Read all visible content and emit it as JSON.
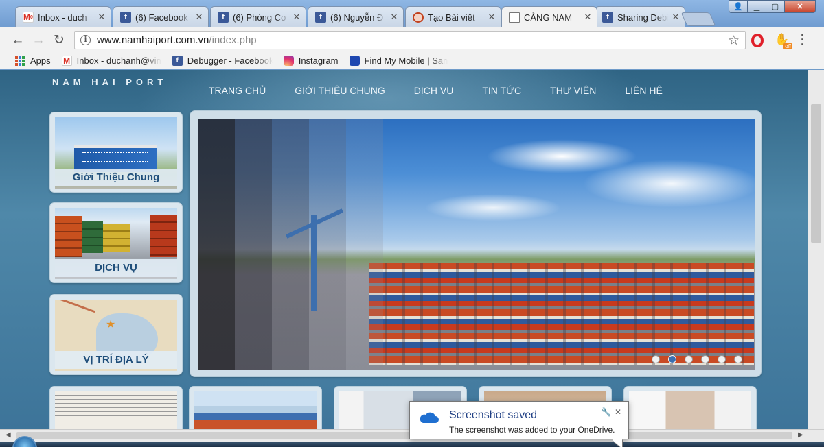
{
  "browser": {
    "tabs": [
      {
        "title": "Inbox - duch",
        "icon": "gmail-icon",
        "active": false
      },
      {
        "title": "(6) Facebook",
        "icon": "facebook-icon",
        "active": false
      },
      {
        "title": "(6) Phòng Co",
        "icon": "facebook-icon",
        "active": false
      },
      {
        "title": "(6) Nguyễn Đ",
        "icon": "facebook-icon",
        "active": false
      },
      {
        "title": "Tạo Bài viết",
        "icon": "globe-icon",
        "active": false
      },
      {
        "title": "CẢNG NAM",
        "icon": "document-icon",
        "active": true
      },
      {
        "title": "Sharing Debi",
        "icon": "facebook-icon",
        "active": false
      }
    ],
    "url_host": "www.namhaiport.com.vn",
    "url_path": "/index.php",
    "extension_badge": "off",
    "bookmarks": [
      {
        "label": "Apps",
        "icon": "apps-icon"
      },
      {
        "label": "Inbox - duchanh@vin",
        "icon": "gmail-icon"
      },
      {
        "label": "Debugger - Facebook",
        "icon": "facebook-icon"
      },
      {
        "label": "Instagram",
        "icon": "instagram-icon"
      },
      {
        "label": "Find My Mobile | San",
        "icon": "find-my-mobile-icon"
      }
    ],
    "gmail_letter": "M",
    "gmail_sub": "0",
    "fb_letter": "f"
  },
  "site": {
    "brand": "NAM HAI PORT",
    "nav": [
      "TRANG CHỦ",
      "GIỚI THIỆU CHUNG",
      "DỊCH VỤ",
      "TIN TỨC",
      "THƯ VIỆN",
      "LIÊN HỆ"
    ],
    "side_cards": [
      {
        "caption": "Giới Thiệu Chung"
      },
      {
        "caption": "DỊCH VỤ"
      },
      {
        "caption": "VỊ TRÍ ĐỊA LÝ"
      }
    ],
    "slider_dots": 6,
    "slider_active_dot": 1
  },
  "toast": {
    "title": "Screenshot saved",
    "message": "The screenshot was added to your OneDrive."
  },
  "colors": {
    "brand_blue": "#1f4e7a",
    "facebook": "#3b5998",
    "opera_red": "#e0202a"
  }
}
